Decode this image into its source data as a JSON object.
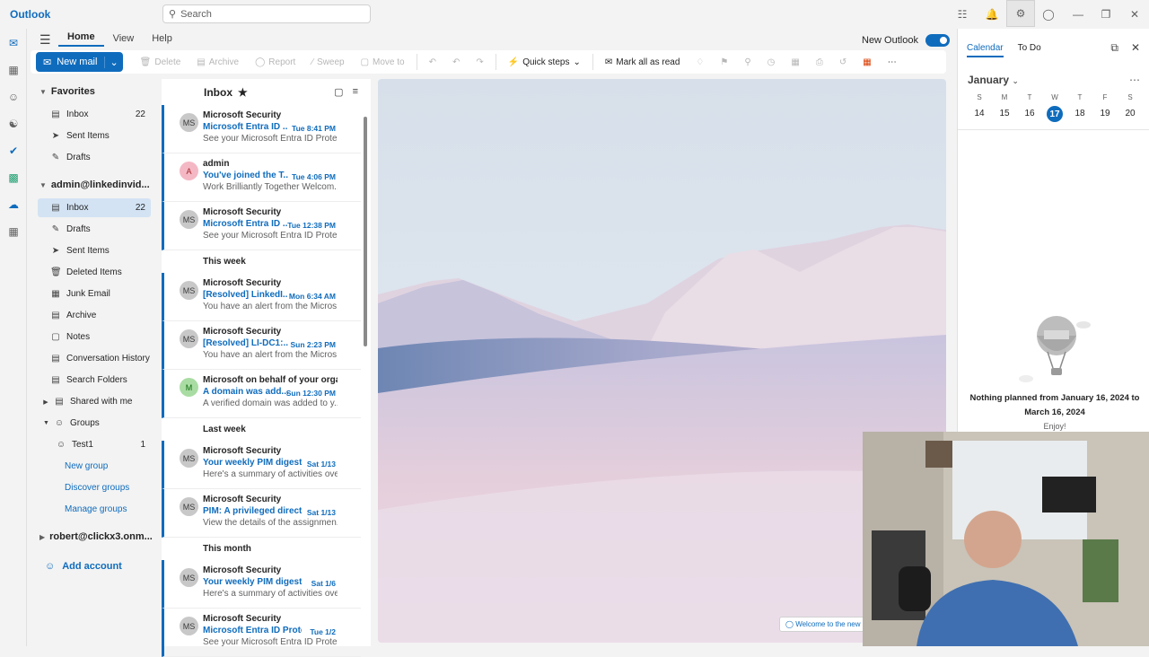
{
  "app": {
    "title": "Outlook"
  },
  "search": {
    "placeholder": "Search"
  },
  "nav": {
    "tabs": [
      "Home",
      "View",
      "Help"
    ],
    "new_outlook": "New Outlook"
  },
  "ribbon": {
    "new_mail": "New mail",
    "delete": "Delete",
    "archive": "Archive",
    "report": "Report",
    "sweep": "Sweep",
    "move_to": "Move to",
    "quick_steps": "Quick steps",
    "mark_all_read": "Mark all as read"
  },
  "favorites": {
    "header": "Favorites",
    "items": [
      {
        "label": "Inbox",
        "count": "22"
      },
      {
        "label": "Sent Items",
        "count": ""
      },
      {
        "label": "Drafts",
        "count": ""
      }
    ]
  },
  "account": {
    "header": "admin@linkedinvid...",
    "items": [
      {
        "label": "Inbox",
        "count": "22"
      },
      {
        "label": "Drafts",
        "count": ""
      },
      {
        "label": "Sent Items",
        "count": ""
      },
      {
        "label": "Deleted Items",
        "count": ""
      },
      {
        "label": "Junk Email",
        "count": ""
      },
      {
        "label": "Archive",
        "count": ""
      },
      {
        "label": "Notes",
        "count": ""
      },
      {
        "label": "Conversation History",
        "count": ""
      },
      {
        "label": "Search Folders",
        "count": ""
      },
      {
        "label": "Shared with me",
        "count": ""
      },
      {
        "label": "Groups",
        "count": ""
      }
    ]
  },
  "groups": {
    "test1": "Test1",
    "test1_count": "1",
    "new_group": "New group",
    "discover": "Discover groups",
    "manage": "Manage groups"
  },
  "account2": {
    "header": "robert@clickx3.onm..."
  },
  "add_account": "Add account",
  "inbox": {
    "title": "Inbox",
    "groups": {
      "this_week": "This week",
      "last_week": "Last week",
      "this_month": "This month"
    },
    "messages": [
      {
        "initials": "MS",
        "from": "Microsoft Security",
        "subject": "Microsoft Entra ID ...",
        "time": "Tue 8:41 PM",
        "preview": "See your Microsoft Entra ID Prote...",
        "avatar_color": "#c8c8c8"
      },
      {
        "initials": "A",
        "from": "admin",
        "subject": "You've joined the T...",
        "time": "Tue 4:06 PM",
        "preview": "Work Brilliantly Together Welcom...",
        "avatar_color": "#f4b8c4"
      },
      {
        "initials": "MS",
        "from": "Microsoft Security",
        "subject": "Microsoft Entra ID ...",
        "time": "Tue 12:38 PM",
        "preview": "See your Microsoft Entra ID Prote...",
        "avatar_color": "#c8c8c8"
      },
      {
        "initials": "MS",
        "from": "Microsoft Security",
        "subject": "[Resolved] LinkedI...",
        "time": "Mon 6:34 AM",
        "preview": "You have an alert from the Micros...",
        "avatar_color": "#c8c8c8"
      },
      {
        "initials": "MS",
        "from": "Microsoft Security",
        "subject": "[Resolved] LI-DC1:...",
        "time": "Sun 2:23 PM",
        "preview": "You have an alert from the Micros...",
        "avatar_color": "#c8c8c8"
      },
      {
        "initials": "M",
        "from": "Microsoft on behalf of your orga...",
        "subject": "A domain was add...",
        "time": "Sun 12:30 PM",
        "preview": "A verified domain was added to y...",
        "avatar_color": "#a9dca3"
      },
      {
        "initials": "MS",
        "from": "Microsoft Security",
        "subject": "Your weekly PIM digest...",
        "time": "Sat 1/13",
        "preview": "Here's a summary of activities ove...",
        "avatar_color": "#c8c8c8"
      },
      {
        "initials": "MS",
        "from": "Microsoft Security",
        "subject": "PIM: A privileged direct...",
        "time": "Sat 1/13",
        "preview": "View the details of the assignmen...",
        "avatar_color": "#c8c8c8"
      },
      {
        "initials": "MS",
        "from": "Microsoft Security",
        "subject": "Your weekly PIM digest ...",
        "time": "Sat 1/6",
        "preview": "Here's a summary of activities ove...",
        "avatar_color": "#c8c8c8"
      },
      {
        "initials": "MS",
        "from": "Microsoft Security",
        "subject": "Microsoft Entra ID Prote...",
        "time": "Tue 1/2",
        "preview": "See your Microsoft Entra ID Prote...",
        "avatar_color": "#c8c8c8"
      }
    ]
  },
  "reading": {
    "welcome": "Welcome to the new"
  },
  "calendar": {
    "tab_calendar": "Calendar",
    "tab_todo": "To Do",
    "month": "January",
    "days": [
      "S",
      "M",
      "T",
      "W",
      "T",
      "F",
      "S"
    ],
    "dates": [
      "14",
      "15",
      "16",
      "17",
      "18",
      "19",
      "20"
    ],
    "today_index": 3,
    "nothing": "Nothing planned from January 16, 2024 to March 16, 2024",
    "enjoy": "Enjoy!"
  },
  "colors": {
    "accent": "#0f6cbd"
  }
}
